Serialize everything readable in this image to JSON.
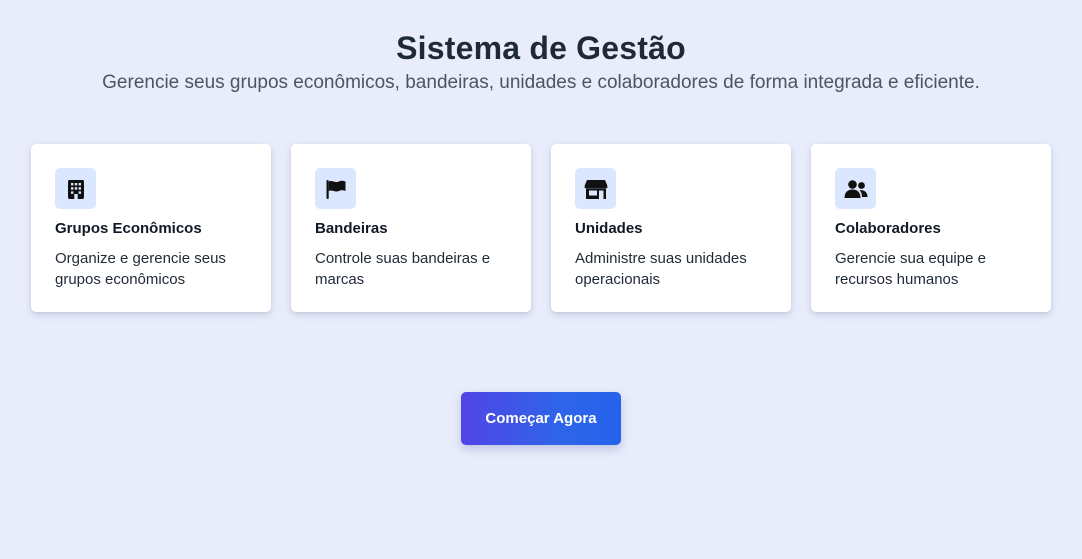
{
  "header": {
    "title": "Sistema de Gestão",
    "subtitle": "Gerencie seus grupos econômicos, bandeiras, unidades e colaboradores de forma integrada e eficiente."
  },
  "cards": [
    {
      "icon": "building-icon",
      "title": "Grupos Econômicos",
      "description": "Organize e gerencie seus grupos econômicos"
    },
    {
      "icon": "flag-icon",
      "title": "Bandeiras",
      "description": "Controle suas bandeiras e marcas"
    },
    {
      "icon": "store-icon",
      "title": "Unidades",
      "description": "Administre suas unidades operacionais"
    },
    {
      "icon": "users-icon",
      "title": "Colaboradores",
      "description": "Gerencie sua equipe e recursos humanos"
    }
  ],
  "cta": {
    "label": "Começar Agora"
  },
  "colors": {
    "background": "#e9edfb",
    "icon_background": "#dbe7fe",
    "cta_gradient_start": "#5145e5",
    "cta_gradient_end": "#2563eb"
  }
}
